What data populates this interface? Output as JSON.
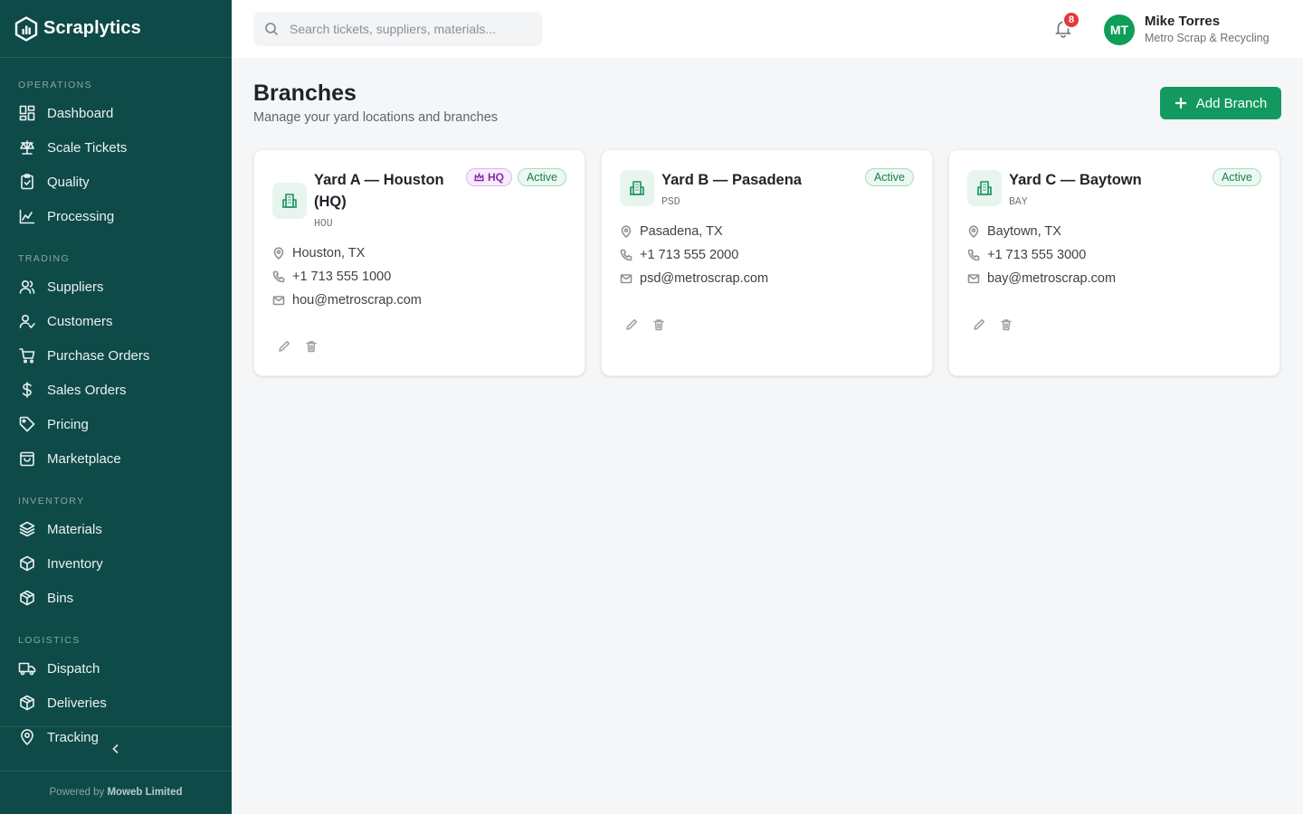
{
  "app": {
    "name": "Scraplytics"
  },
  "sidebar": {
    "sections": [
      {
        "label": "OPERATIONS",
        "items": [
          {
            "label": "Dashboard",
            "icon": "dashboard-icon"
          },
          {
            "label": "Scale Tickets",
            "icon": "scale-icon"
          },
          {
            "label": "Quality",
            "icon": "clipboard-check-icon"
          },
          {
            "label": "Processing",
            "icon": "factory-icon"
          }
        ]
      },
      {
        "label": "TRADING",
        "items": [
          {
            "label": "Suppliers",
            "icon": "users-icon"
          },
          {
            "label": "Customers",
            "icon": "user-check-icon"
          },
          {
            "label": "Purchase Orders",
            "icon": "cart-icon"
          },
          {
            "label": "Sales Orders",
            "icon": "dollar-icon"
          },
          {
            "label": "Pricing",
            "icon": "tag-icon"
          },
          {
            "label": "Marketplace",
            "icon": "shopping-bag-icon"
          }
        ]
      },
      {
        "label": "INVENTORY",
        "items": [
          {
            "label": "Materials",
            "icon": "layers-icon"
          },
          {
            "label": "Inventory",
            "icon": "box-icon"
          },
          {
            "label": "Bins",
            "icon": "package-icon"
          }
        ]
      },
      {
        "label": "LOGISTICS",
        "items": [
          {
            "label": "Dispatch",
            "icon": "truck-icon"
          },
          {
            "label": "Deliveries",
            "icon": "package-check-icon"
          },
          {
            "label": "Tracking",
            "icon": "map-pin-icon"
          }
        ]
      }
    ],
    "powered_prefix": "Powered by",
    "powered_company": "Moweb Limited"
  },
  "topbar": {
    "search_placeholder": "Search tickets, suppliers, materials...",
    "notification_count": "8",
    "user_initials": "MT",
    "user_name": "Mike Torres",
    "user_org": "Metro Scrap & Recycling"
  },
  "page": {
    "title": "Branches",
    "subtitle": "Manage your yard locations and branches",
    "add_button": "Add Branch"
  },
  "branches": [
    {
      "name": "Yard A — Houston (HQ)",
      "code": "HOU",
      "hq_label": "HQ",
      "status": "Active",
      "location": "Houston, TX",
      "phone": "+1 713 555 1000",
      "email": "hou@metroscrap.com"
    },
    {
      "name": "Yard B — Pasadena",
      "code": "PSD",
      "status": "Active",
      "location": "Pasadena, TX",
      "phone": "+1 713 555 2000",
      "email": "psd@metroscrap.com"
    },
    {
      "name": "Yard C — Baytown",
      "code": "BAY",
      "status": "Active",
      "location": "Baytown, TX",
      "phone": "+1 713 555 3000",
      "email": "bay@metroscrap.com"
    }
  ],
  "colors": {
    "sidebar_bg": "#0e4a48",
    "accent": "#139960",
    "badge_red": "#e23b3b",
    "hq_purple": "#8a2ab0"
  }
}
